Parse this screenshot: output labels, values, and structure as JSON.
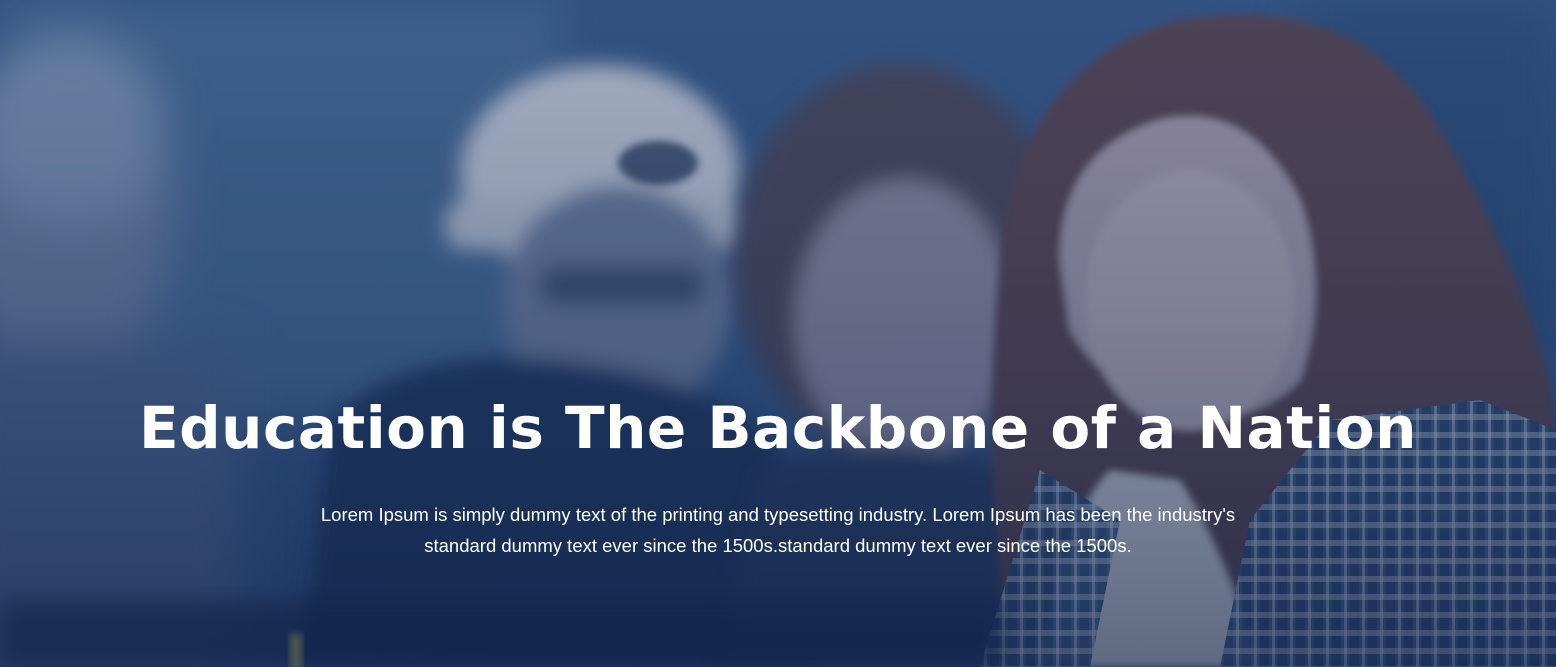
{
  "hero": {
    "title": "Education is The Backbone of a Nation",
    "subtitle": "Lorem Ipsum is simply dummy text of the printing and typesetting industry. Lorem Ipsum has been the industry's standard dummy text ever since the 1500s.standard dummy text ever since the 1500s.",
    "background_image": "photo of students studying, blurred, with blue overlay",
    "colors": {
      "overlay": "#1f3a63",
      "text": "#ffffff"
    }
  }
}
